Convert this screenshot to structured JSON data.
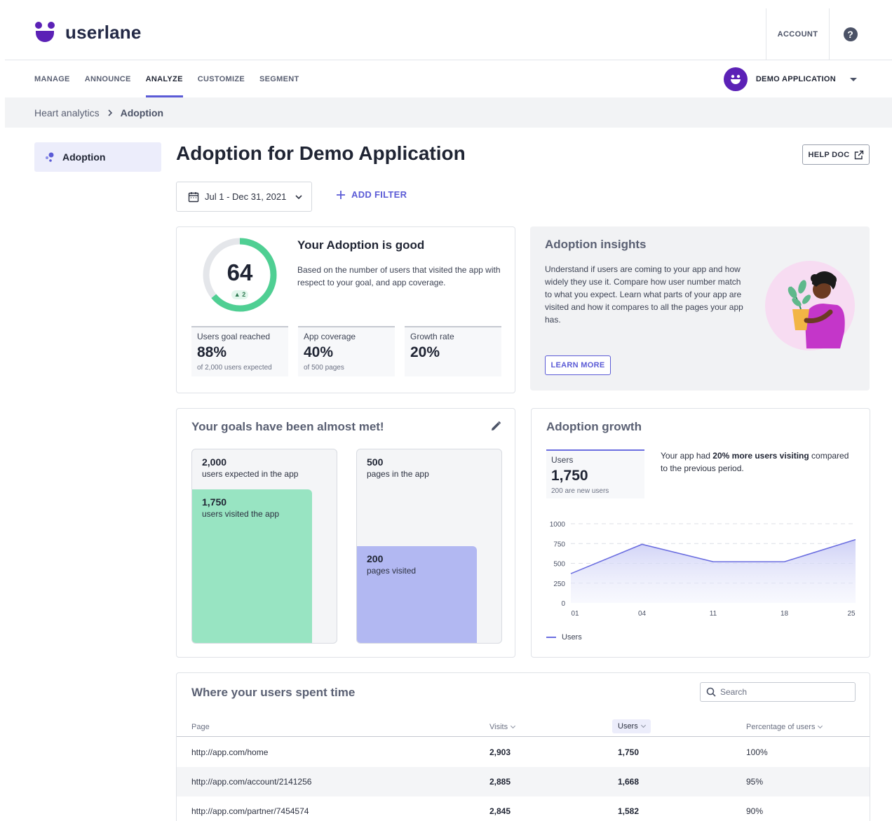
{
  "brand": {
    "name": "userlane",
    "color": "#5b21b6",
    "accent": "#5b5bd6"
  },
  "header": {
    "account_label": "ACCOUNT",
    "help_icon": "question-circle-icon"
  },
  "nav": {
    "items": [
      "MANAGE",
      "ANNOUNCE",
      "ANALYZE",
      "CUSTOMIZE",
      "SEGMENT"
    ],
    "active": "ANALYZE",
    "app_name": "DEMO APPLICATION"
  },
  "breadcrumb": {
    "parent": "Heart analytics",
    "current": "Adoption"
  },
  "sidebar": {
    "item": "Adoption"
  },
  "page": {
    "title": "Adoption for Demo Application",
    "help_doc": "HELP DOC",
    "date_range": "Jul 1 - Dec 31, 2021",
    "add_filter": "ADD FILTER"
  },
  "score": {
    "value": "64",
    "fraction": 0.64,
    "delta": "2",
    "title": "Your Adoption is good",
    "description": "Based on the number of users that visited the app with respect to your goal, and app coverage.",
    "metrics": [
      {
        "label": "Users goal reached",
        "value": "88%",
        "sub": "of 2,000 users expected"
      },
      {
        "label": "App coverage",
        "value": "40%",
        "sub": "of 500 pages"
      },
      {
        "label": "Growth rate",
        "value": "20%",
        "sub": ""
      }
    ]
  },
  "insights": {
    "title": "Adoption insights",
    "body": "Understand if users are coming to your app and how widely they use it. Compare how user number match to what you expect. Learn what parts of your app are visited and how it compares to all the pages your app has.",
    "learn_more": "LEARN MORE"
  },
  "goals": {
    "title": "Your goals have been almost met!",
    "users": {
      "expected": "2,000",
      "expected_text": "users expected in the app",
      "visited": "1,750",
      "visited_text": "users visited the app",
      "fraction": 0.875,
      "color": "#98e4c2"
    },
    "pages": {
      "total": "500",
      "total_text": "pages in the app",
      "visited": "200",
      "visited_text": "pages visited",
      "fraction": 0.4,
      "color": "#b2b8f2"
    }
  },
  "growth": {
    "title": "Adoption growth",
    "users_label": "Users",
    "users_value": "1,750",
    "users_sub": "200 are new users",
    "text_pre": "Your app had ",
    "text_bold": "20% more users visiting",
    "text_post": " compared to the previous period.",
    "legend": "Users"
  },
  "chart_data": {
    "type": "area",
    "x": [
      "01",
      "04",
      "11",
      "18",
      "25"
    ],
    "series": [
      {
        "name": "Users",
        "values": [
          370,
          740,
          520,
          520,
          800
        ]
      }
    ],
    "yticks": [
      0,
      250,
      500,
      750,
      1000
    ],
    "ylim": [
      0,
      1000
    ],
    "grid": true,
    "legend": "bottom-left",
    "color": "#6b6ee0"
  },
  "table": {
    "title": "Where your users spent time",
    "search_placeholder": "Search",
    "columns": [
      "Page",
      "Visits",
      "Users",
      "Percentage of users"
    ],
    "sorted_column": "Users",
    "rows": [
      [
        "http://app.com/home",
        "2,903",
        "1,750",
        "100%"
      ],
      [
        "http://app.com/account/2141256",
        "2,885",
        "1,668",
        "95%"
      ],
      [
        "http://app.com/partner/7454574",
        "2,845",
        "1,582",
        "90%"
      ]
    ]
  }
}
